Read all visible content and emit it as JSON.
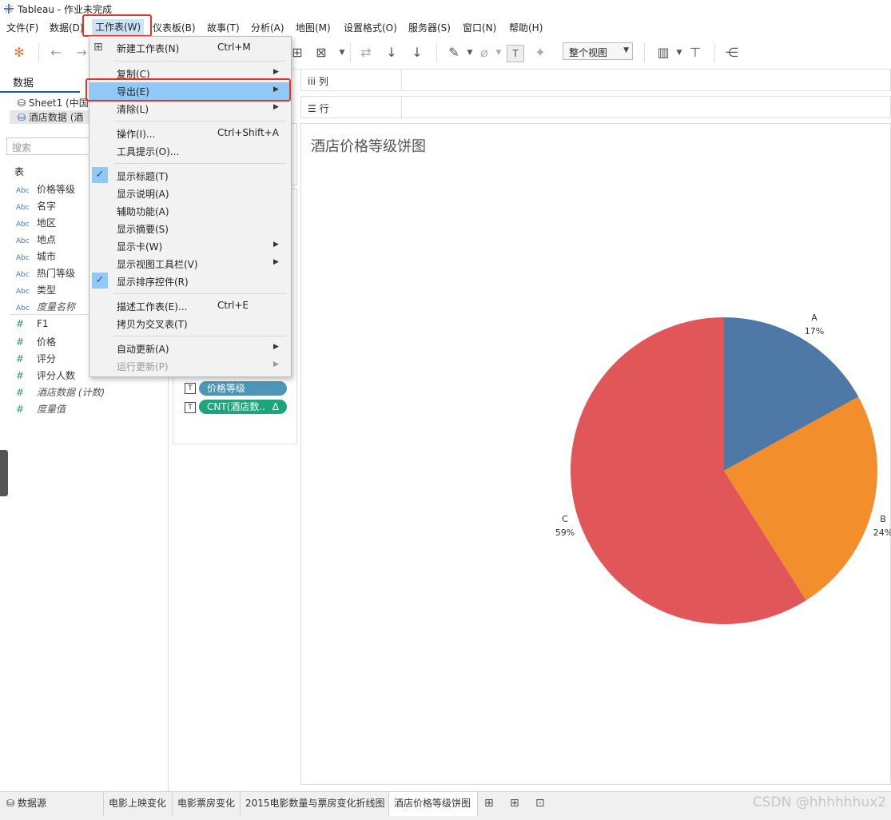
{
  "window": {
    "title": "Tableau - 作业未完成"
  },
  "menubar": {
    "items": [
      "文件(F)",
      "数据(D)",
      "工作表(W)",
      "仪表板(B)",
      "故事(T)",
      "分析(A)",
      "地图(M)",
      "设置格式(O)",
      "服务器(S)",
      "窗口(N)",
      "帮助(H)"
    ],
    "active": "工作表(W)"
  },
  "toolbar": {
    "view_select": "整个视图"
  },
  "data_pane": {
    "tab": "数据",
    "sources": [
      "Sheet1 (中国",
      "酒店数据 (酒"
    ],
    "search_placeholder": "搜索",
    "table_header": "表",
    "dimensions": [
      "价格等级",
      "名字",
      "地区",
      "地点",
      "城市",
      "热门等级",
      "类型",
      "度量名称"
    ],
    "measures": [
      "F1",
      "价格",
      "评分",
      "评分人数",
      "酒店数据 (计数)",
      "度量值"
    ],
    "dim_type": "Abc",
    "measure_type": "#"
  },
  "shelves": {
    "columns": "列",
    "rows": "行"
  },
  "marks": {
    "pill_1": "价格等级",
    "pill_2": "CNT(酒店数..",
    "pill_2_delta": "Δ",
    "text_mark": "T"
  },
  "view": {
    "title": "酒店价格等级饼图"
  },
  "chart_data": {
    "type": "pie",
    "title": "酒店价格等级饼图",
    "categories": [
      "A",
      "B",
      "C"
    ],
    "values": [
      17,
      24,
      59
    ],
    "labels": [
      "17%",
      "24%",
      "59%"
    ],
    "colors": [
      "#4e79a7",
      "#f28e2b",
      "#e15759"
    ]
  },
  "dropdown": {
    "items": [
      {
        "label": "新建工作表(N)",
        "shortcut": "Ctrl+M",
        "sub": false
      },
      {
        "label": "复制(C)",
        "shortcut": "",
        "sub": true
      },
      {
        "label": "导出(E)",
        "shortcut": "",
        "sub": true,
        "highlight": true
      },
      {
        "label": "清除(L)",
        "shortcut": "",
        "sub": true
      },
      {
        "label": "操作(I)...",
        "shortcut": "Ctrl+Shift+A",
        "sub": false
      },
      {
        "label": "工具提示(O)...",
        "shortcut": "",
        "sub": false
      },
      {
        "label": "显示标题(T)",
        "shortcut": "",
        "sub": false,
        "checked": true
      },
      {
        "label": "显示说明(A)",
        "shortcut": "",
        "sub": false
      },
      {
        "label": "辅助功能(A)",
        "shortcut": "",
        "sub": false
      },
      {
        "label": "显示摘要(S)",
        "shortcut": "",
        "sub": false
      },
      {
        "label": "显示卡(W)",
        "shortcut": "",
        "sub": true
      },
      {
        "label": "显示视图工具栏(V)",
        "shortcut": "",
        "sub": true
      },
      {
        "label": "显示排序控件(R)",
        "shortcut": "",
        "sub": false,
        "checked": true
      },
      {
        "label": "描述工作表(E)...",
        "shortcut": "Ctrl+E",
        "sub": false
      },
      {
        "label": "拷贝为交叉表(T)",
        "shortcut": "",
        "sub": false
      },
      {
        "label": "自动更新(A)",
        "shortcut": "",
        "sub": true
      },
      {
        "label": "运行更新(P)",
        "shortcut": "",
        "sub": true,
        "disabled": true
      }
    ]
  },
  "bottom_tabs": {
    "datasource": "数据源",
    "sheets": [
      "电影上映变化",
      "电影票房变化",
      "2015电影数量与票房变化折线图",
      "酒店价格等级饼图"
    ],
    "active": "酒店价格等级饼图"
  },
  "watermark": "CSDN @hhhhhhux2"
}
